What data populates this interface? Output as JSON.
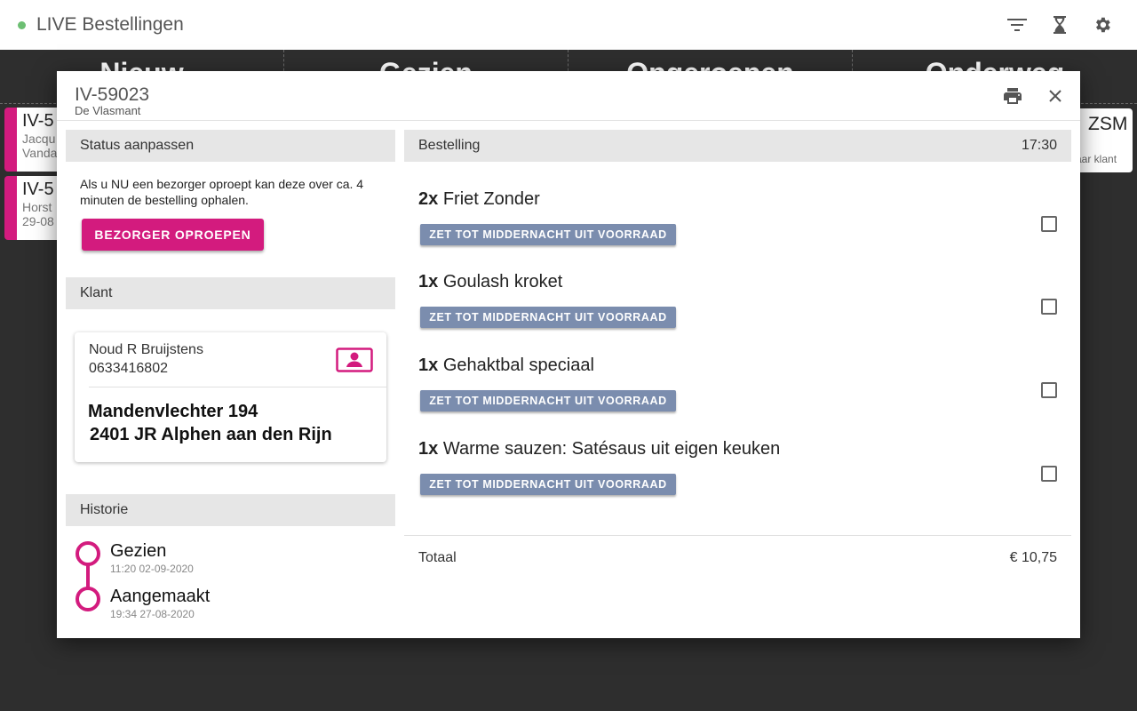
{
  "appbar": {
    "title": "LIVE Bestellingen",
    "status_color": "#6dbf73",
    "icons": [
      "filter-icon",
      "hourglass-icon",
      "settings-gear-icon"
    ]
  },
  "board": {
    "columns": [
      "Nieuw",
      "Gezien",
      "Opgeroepen",
      "Onderweg"
    ],
    "cards": [
      {
        "id": "IV-5",
        "line1": "Jacqu",
        "line2": "Vanda"
      },
      {
        "id": "IV-5",
        "line1": "Horst",
        "line2": "29-08"
      }
    ],
    "right_card": {
      "label": "ZSM",
      "sub": "aar klant"
    }
  },
  "dialog": {
    "order_id": "IV-59023",
    "shop": "De Vlasmant",
    "status_section": {
      "title": "Status aanpassen",
      "text": "Als u NU een bezorger oproept kan deze over ca. 4 minuten de bestelling ophalen.",
      "button": "BEZORGER OPROEPEN"
    },
    "client_section": {
      "title": "Klant",
      "name": "Noud R Bruijstens",
      "phone": "0633416802",
      "address_line1": "Mandenvlechter 194",
      "address_line2": "2401 JR Alphen aan den Rijn"
    },
    "history_section": {
      "title": "Historie",
      "events": [
        {
          "label": "Gezien",
          "time": "11:20 02-09-2020"
        },
        {
          "label": "Aangemaakt",
          "time": "19:34 27-08-2020"
        }
      ]
    },
    "order_section": {
      "title": "Bestelling",
      "time": "17:30",
      "items": [
        {
          "qty": "2x",
          "name": "Friet Zonder",
          "button": "ZET TOT MIDDERNACHT UIT VOORRAAD"
        },
        {
          "qty": "1x",
          "name": "Goulash kroket",
          "button": "ZET TOT MIDDERNACHT UIT VOORRAAD"
        },
        {
          "qty": "1x",
          "name": "Gehaktbal speciaal",
          "button": "ZET TOT MIDDERNACHT UIT VOORRAAD"
        },
        {
          "qty": "1x",
          "name": "Warme sauzen: Satésaus uit eigen keuken",
          "button": "ZET TOT MIDDERNACHT UIT VOORRAAD"
        }
      ],
      "total_label": "Totaal",
      "total_value": "€ 10,75"
    }
  },
  "colors": {
    "accent": "#d31b7e",
    "stock_button": "#7b8dae",
    "section_bar": "#e6e6e6",
    "backdrop": "#2e2e2e"
  }
}
